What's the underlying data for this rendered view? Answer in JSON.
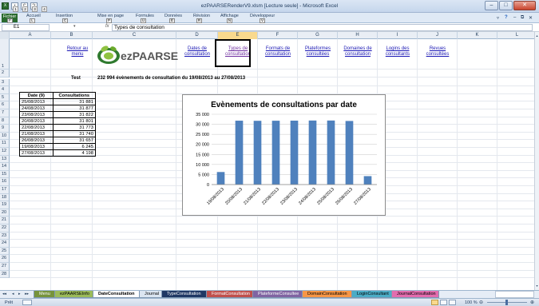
{
  "window": {
    "title": "ezPAARSERenderV9.xlsm  [Lecture seule] - Microsoft Excel",
    "minimize": "–",
    "restore": "□",
    "close": "✕"
  },
  "quick_access": {
    "icons": [
      "excel-app-icon",
      "save-icon",
      "undo-icon",
      "redo-icon"
    ],
    "keytips": [
      "1",
      "2",
      "3",
      "4"
    ]
  },
  "ribbon": {
    "file_tab": "Fichier",
    "file_keytip": "F",
    "tabs": [
      {
        "label": "Accueil",
        "keytip": "L"
      },
      {
        "label": "Insertion",
        "keytip": "C"
      },
      {
        "label": "Mise en page",
        "keytip": "P"
      },
      {
        "label": "Formules",
        "keytip": "U"
      },
      {
        "label": "Données",
        "keytip": "É"
      },
      {
        "label": "Révision",
        "keytip": "R"
      },
      {
        "label": "Affichage",
        "keytip": "N"
      },
      {
        "label": "Développeur",
        "keytip": "V"
      }
    ]
  },
  "formula_bar": {
    "name_box": "E1",
    "fx": "fx",
    "content": "Types de consultation"
  },
  "columns": [
    "A",
    "B",
    "C",
    "D",
    "E",
    "F",
    "G",
    "H",
    "I",
    "J",
    "K",
    "L",
    "M"
  ],
  "selected_column": "E",
  "rows": [
    "1",
    "2",
    "3",
    "4",
    "5",
    "6",
    "7",
    "8",
    "9",
    "10",
    "11",
    "12",
    "13",
    "14",
    "15",
    "16",
    "17",
    "18",
    "19",
    "20",
    "21",
    "22",
    "23",
    "24",
    "25",
    "26",
    "27",
    "28"
  ],
  "sheet_content": {
    "retour_link": "Retour au menu",
    "logo_text": "ezPAARSE",
    "nav_links": [
      "Dates de consultation",
      "Types de consultation",
      "Formats de consultation",
      "Plateformes consultées",
      "Domaines de consultation",
      "Logins des consultants",
      "Revues consultées"
    ],
    "test_label": "Test",
    "summary": "232 994 évènements de consultation du 19/08/2013 au 27/08/2013"
  },
  "table": {
    "headers": [
      "Date (9)",
      "Consultations"
    ],
    "rows": [
      [
        "25/08/2013",
        "31 881"
      ],
      [
        "24/08/2013",
        "31 877"
      ],
      [
        "23/08/2013",
        "31 822"
      ],
      [
        "20/08/2013",
        "31 801"
      ],
      [
        "22/08/2013",
        "31 773"
      ],
      [
        "21/08/2013",
        "31 740"
      ],
      [
        "26/08/2013",
        "31 657"
      ],
      [
        "19/08/2013",
        "6 245"
      ],
      [
        "27/08/2013",
        "4 198"
      ]
    ]
  },
  "chart_data": {
    "type": "bar",
    "title": "Evènements de consultations par date",
    "categories": [
      "19/08/2013",
      "20/08/2013",
      "21/08/2013",
      "22/08/2013",
      "23/08/2013",
      "24/08/2013",
      "25/08/2013",
      "26/08/2013",
      "27/08/2013"
    ],
    "values": [
      6245,
      31801,
      31740,
      31773,
      31822,
      31877,
      31881,
      31657,
      4198
    ],
    "ylim": [
      0,
      35000
    ],
    "yticks": [
      0,
      5000,
      10000,
      15000,
      20000,
      25000,
      30000,
      35000
    ],
    "ytick_labels": [
      "0",
      "5 000",
      "10 000",
      "15 000",
      "20 000",
      "25 000",
      "30 000",
      "35 000"
    ],
    "grid": true,
    "bar_color": "#4f81bd"
  },
  "sheet_tabs": [
    {
      "label": "Menu",
      "color": "#76933c",
      "active": false
    },
    {
      "label": "ezPAARSEInfo",
      "color": "#9bbb59",
      "active": false
    },
    {
      "label": "DateConsultation",
      "color": "#ffffff",
      "active": true
    },
    {
      "label": "Journal",
      "color": "#dbe5f1",
      "active": false
    },
    {
      "label": "TypeConsultation",
      "color": "#1f3864",
      "active": false
    },
    {
      "label": "FormatConsultation",
      "color": "#c0504d",
      "active": false
    },
    {
      "label": "PlateformeConsultee",
      "color": "#8064a2",
      "active": false
    },
    {
      "label": "DomainConsultation",
      "color": "#f79646",
      "active": false
    },
    {
      "label": "LoginConsultant",
      "color": "#4bacc6",
      "active": false
    },
    {
      "label": "JournalConsultation",
      "color": "#e36cae",
      "active": false
    }
  ],
  "status": {
    "ready": "Prêt",
    "zoom": "100 %"
  }
}
